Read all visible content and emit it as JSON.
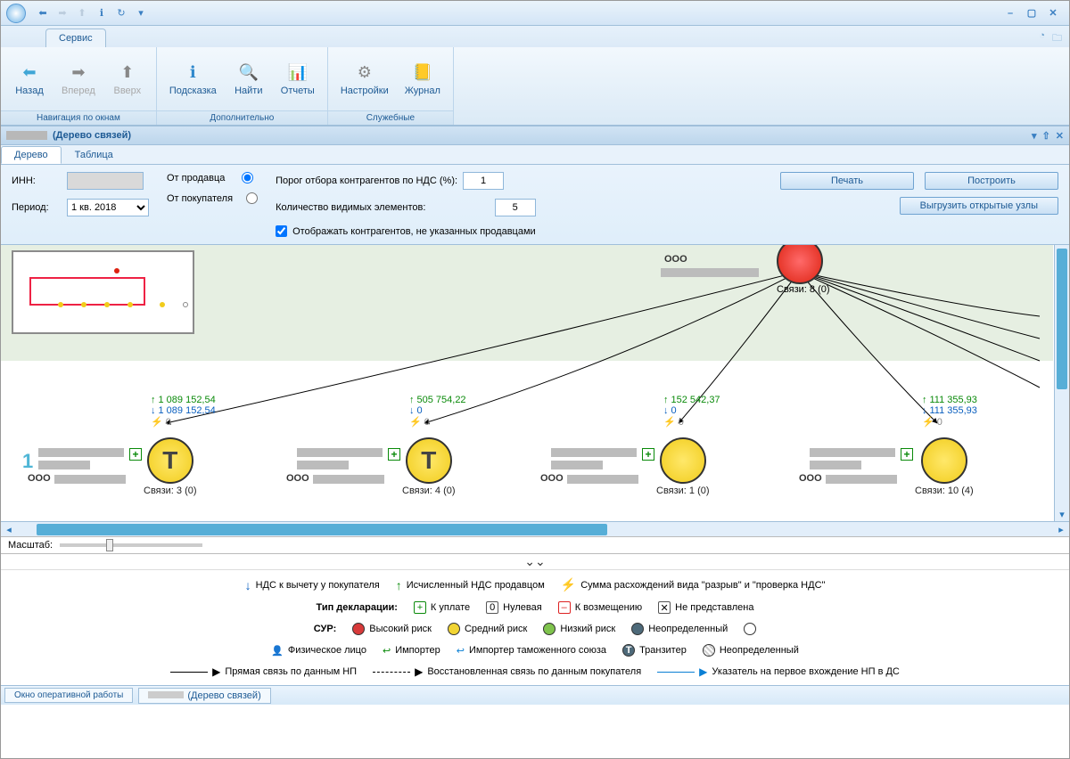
{
  "titlebar": {
    "minimize": "–",
    "maximize": "▢",
    "close": "✕"
  },
  "ribbon_tab": "Сервис",
  "ribbon": {
    "groups": [
      {
        "label": "Навигация по окнам",
        "buttons": [
          {
            "name": "back-button",
            "icon": "⬅",
            "label": "Назад",
            "color": "#3fa6d6"
          },
          {
            "name": "forward-button",
            "icon": "➡",
            "label": "Вперед",
            "disabled": true
          },
          {
            "name": "up-button",
            "icon": "⬆",
            "label": "Вверх",
            "disabled": true
          }
        ]
      },
      {
        "label": "Дополнительно",
        "buttons": [
          {
            "name": "hint-button",
            "icon": "ℹ",
            "label": "Подсказка",
            "color": "#2f88cc"
          },
          {
            "name": "find-button",
            "icon": "🔍",
            "label": "Найти"
          },
          {
            "name": "reports-button",
            "icon": "📊",
            "label": "Отчеты"
          }
        ]
      },
      {
        "label": "Служебные",
        "buttons": [
          {
            "name": "settings-button",
            "icon": "⚙",
            "label": "Настройки"
          },
          {
            "name": "journal-button",
            "icon": "📒",
            "label": "Журнал",
            "color": "#e6b43c"
          }
        ]
      }
    ]
  },
  "doc_title": "(Дерево связей)",
  "view_tabs": {
    "tree": "Дерево",
    "table": "Таблица"
  },
  "filter": {
    "inn_label": "ИНН:",
    "inn_value": "",
    "period_label": "Период:",
    "period_value": "1 кв. 2018",
    "from_seller": "От продавца",
    "from_buyer": "От покупателя",
    "threshold_label": "Порог отбора контрагентов по НДС (%):",
    "threshold_value": "1",
    "visible_label": "Количество видимых элементов:",
    "visible_value": "5",
    "show_cb": "Отображать контрагентов, не указанных продавцами",
    "print_btn": "Печать",
    "build_btn": "Построить",
    "export_btn": "Выгрузить открытые узлы"
  },
  "graph": {
    "root": {
      "ooo": "ООО",
      "links": "Связи: 8 (0)"
    },
    "level1_num": "1",
    "children": [
      {
        "up": "1 089 152,54",
        "down": "1 089 152,54",
        "bolt": "0",
        "ooo": "ООО",
        "links": "Связи: 3 (0)",
        "transit": true
      },
      {
        "up": "505 754,22",
        "down": "0",
        "bolt": "0",
        "ooo": "ООО",
        "links": "Связи: 4 (0)",
        "transit": true
      },
      {
        "up": "152 542,37",
        "down": "0",
        "bolt": "0",
        "ooo": "ООО",
        "links": "Связи: 1 (0)",
        "transit": false
      },
      {
        "up": "111 355,93",
        "down": "111 355,93",
        "bolt": "0",
        "ooo": "ООО",
        "links": "Связи: 10 (4)",
        "transit": false
      }
    ]
  },
  "zoom_label": "Масштаб:",
  "legend": {
    "row1": {
      "buyer_vat": "НДС к вычету у покупателя",
      "seller_vat": "Исчисленный НДС продавцом",
      "discrepancy": "Сумма расхождений вида \"разрыв\" и \"проверка НДС\""
    },
    "row2": {
      "decl_label": "Тип декларации:",
      "pay": "К уплате",
      "zero": "Нулевая",
      "refund": "К возмещению",
      "none": "Не представлена"
    },
    "row3": {
      "sur_label": "СУР:",
      "high": "Высокий риск",
      "mid": "Средний риск",
      "low": "Низкий риск",
      "undef": "Неопределенный"
    },
    "row4": {
      "ind": "Физическое лицо",
      "imp": "Импортер",
      "imp_cu": "Импортер таможенного союза",
      "transit": "Транзитер",
      "undef": "Неопределенный"
    },
    "row5": {
      "direct": "Прямая связь по данным НП",
      "restored": "Восстановленная связь по данным покупателя",
      "pointer": "Указатель на первое вхождение НП в ДС"
    }
  },
  "status": {
    "tab1": "Окно оперативной работы",
    "tab2": "(Дерево связей)"
  }
}
